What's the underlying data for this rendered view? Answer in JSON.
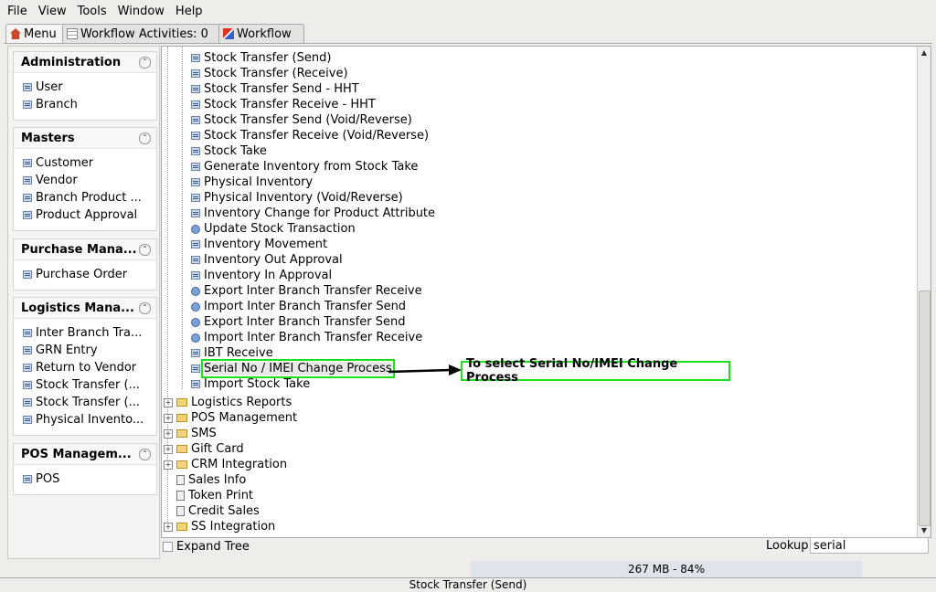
{
  "menubar": {
    "file": "File",
    "view": "View",
    "tools": "Tools",
    "window": "Window",
    "help": "Help"
  },
  "tabs": {
    "menu": "Menu",
    "workflow_activities": "Workflow Activities: 0",
    "workflow": "Workflow"
  },
  "sidebar": {
    "groups": [
      {
        "title": "Administration",
        "items": [
          "User",
          "Branch"
        ]
      },
      {
        "title": "Masters",
        "items": [
          "Customer",
          "Vendor",
          "Branch Product ...",
          "Product Approval"
        ]
      },
      {
        "title": "Purchase Mana...",
        "items": [
          "Purchase Order"
        ]
      },
      {
        "title": "Logistics Mana...",
        "items": [
          "Inter Branch Tra...",
          "GRN Entry",
          "Return to Vendor",
          "Stock Transfer (...",
          "Stock Transfer (...",
          "Physical Invento..."
        ]
      },
      {
        "title": "POS Managem...",
        "items": [
          "POS"
        ]
      }
    ]
  },
  "tree": {
    "items": [
      "Stock Transfer (Send)",
      "Stock Transfer (Receive)",
      "Stock Transfer Send - HHT",
      "Stock Transfer Receive - HHT",
      "Stock Transfer Send (Void/Reverse)",
      "Stock Transfer Receive (Void/Reverse)",
      "Stock Take",
      "Generate Inventory from Stock Take",
      "Physical Inventory",
      "Physical Inventory (Void/Reverse)",
      "Inventory Change for Product Attribute",
      "Update Stock Transaction",
      "Inventory Movement",
      "Inventory Out Approval",
      "Inventory In Approval",
      "Export Inter Branch Transfer Receive",
      "Import Inter Branch Transfer Send",
      "Export Inter Branch Transfer Send",
      "Import Inter Branch Transfer Receive",
      "IBT Receive",
      "Serial No / IMEI Change Process",
      "Import Stock Take"
    ],
    "folders": [
      "Logistics Reports",
      "POS Management",
      "SMS",
      "Gift Card",
      "CRM Integration"
    ],
    "leaves": [
      "Sales Info",
      "Token Print",
      "Credit Sales"
    ],
    "last_folder": "SS Integration"
  },
  "callout": "To select Serial No/IMEI Change Process",
  "bottom": {
    "expand_tree": "Expand Tree",
    "lookup_label": "Lookup",
    "lookup_value": "serial"
  },
  "memory": "267 MB - 84%",
  "status": "Stock Transfer (Send)"
}
